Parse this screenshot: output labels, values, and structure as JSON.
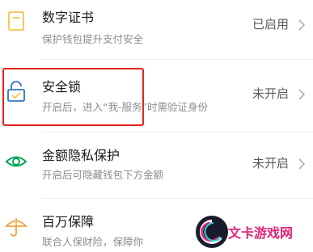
{
  "settings_list": {
    "items": [
      {
        "title": "数字证书",
        "subtitle": "保护钱包提升支付安全",
        "status": "已启用",
        "icon": "certificate-icon"
      },
      {
        "title": "安全锁",
        "subtitle": "开启后，进入“我-服务”时需验证身份",
        "status": "未开启",
        "icon": "lock-icon"
      },
      {
        "title": "金额隐私保护",
        "subtitle": "开启后可隐藏钱包下方金额",
        "status": "未开启",
        "icon": "eye-icon"
      },
      {
        "title": "百万保障",
        "subtitle": "联合人保财险，保障你",
        "status": "",
        "icon": "umbrella-icon"
      }
    ]
  },
  "watermark": {
    "text": "文卡游戏网"
  },
  "colors": {
    "icon_green": "#07a35a",
    "icon_yellow": "#f3c448",
    "icon_orange": "#f0a23c",
    "icon_blue": "#2c76c9",
    "highlight_red": "#e0241b",
    "watermark_pink": "#e0247a"
  }
}
